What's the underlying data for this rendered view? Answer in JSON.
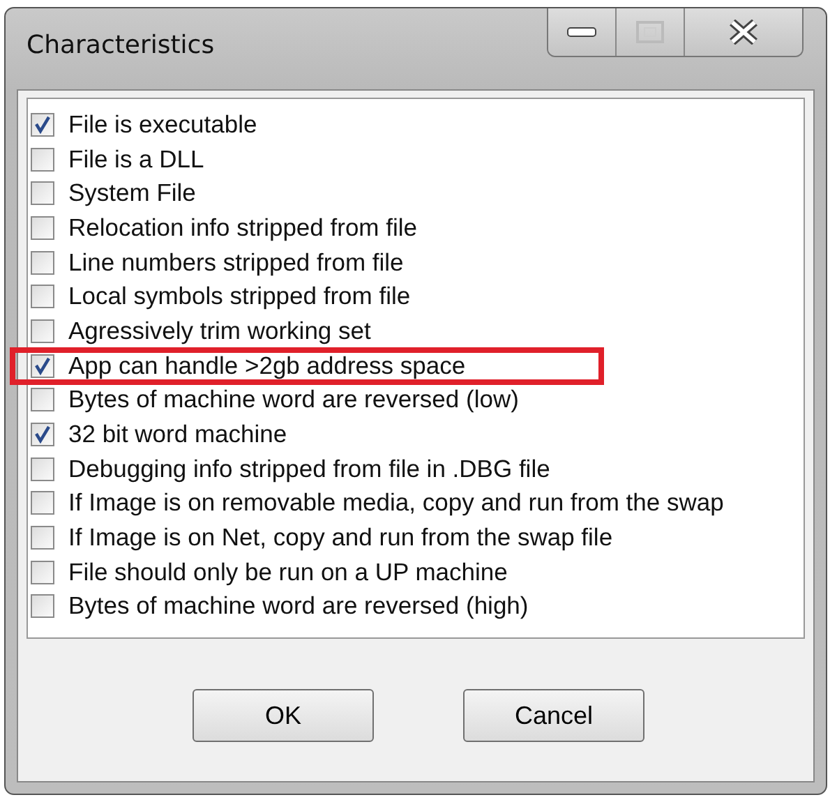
{
  "window": {
    "title": "Characteristics"
  },
  "items": [
    {
      "label": "File is executable",
      "checked": true,
      "highlighted": false
    },
    {
      "label": "File is a DLL",
      "checked": false,
      "highlighted": false
    },
    {
      "label": "System File",
      "checked": false,
      "highlighted": false
    },
    {
      "label": "Relocation info stripped from file",
      "checked": false,
      "highlighted": false
    },
    {
      "label": "Line numbers stripped from file",
      "checked": false,
      "highlighted": false
    },
    {
      "label": "Local symbols stripped from file",
      "checked": false,
      "highlighted": false
    },
    {
      "label": "Agressively trim working set",
      "checked": false,
      "highlighted": false
    },
    {
      "label": "App can handle >2gb address space",
      "checked": true,
      "highlighted": true
    },
    {
      "label": "Bytes of machine word are reversed (low)",
      "checked": false,
      "highlighted": false
    },
    {
      "label": "32 bit word machine",
      "checked": true,
      "highlighted": false
    },
    {
      "label": "Debugging info stripped from file in .DBG file",
      "checked": false,
      "highlighted": false
    },
    {
      "label": "If Image is on removable media, copy and run from the swap",
      "checked": false,
      "highlighted": false
    },
    {
      "label": "If Image is on Net, copy and run from the swap file",
      "checked": false,
      "highlighted": false
    },
    {
      "label": "File should only be run on a UP machine",
      "checked": false,
      "highlighted": false
    },
    {
      "label": "Bytes of machine word are reversed (high)",
      "checked": false,
      "highlighted": false
    }
  ],
  "buttons": [
    {
      "label": "OK"
    },
    {
      "label": "Cancel"
    }
  ]
}
